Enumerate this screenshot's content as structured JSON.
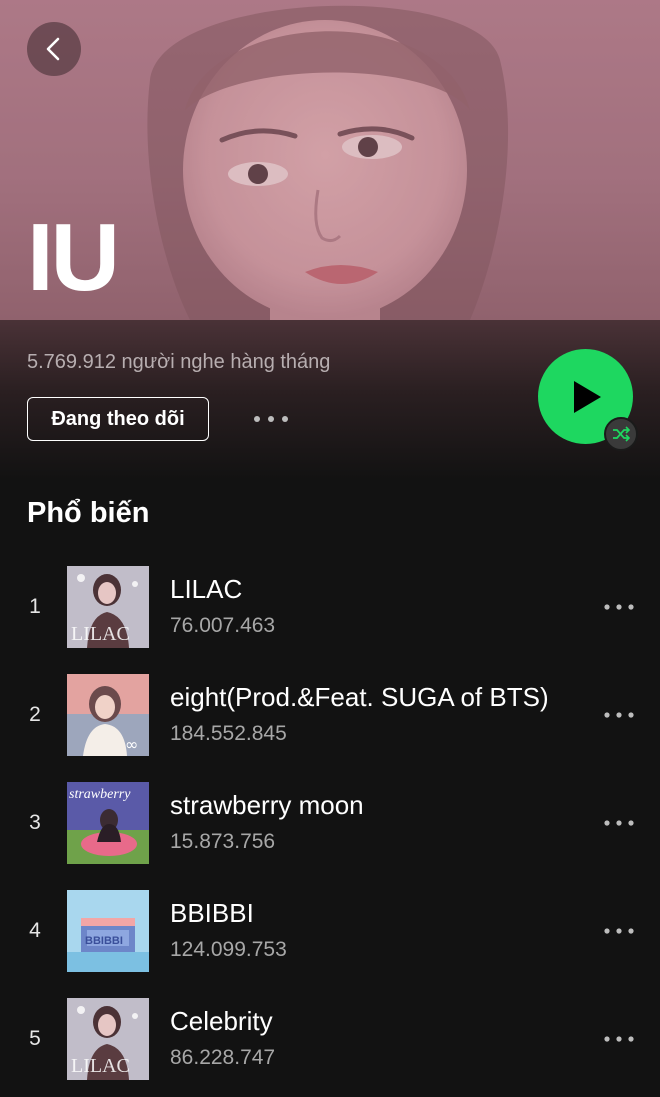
{
  "artist": {
    "name": "IU",
    "monthly_listeners": "5.769.912 người nghe hàng tháng",
    "follow_label": "Đang theo dõi"
  },
  "icons": {
    "back": "chevron-left-icon",
    "more": "more-horizontal-icon",
    "play": "play-icon",
    "shuffle": "shuffle-icon"
  },
  "colors": {
    "accent": "#1ed760",
    "background": "#121212",
    "hero": "#a47280",
    "secondary_text": "#a7a7a7"
  },
  "popular": {
    "title": "Phổ biến",
    "tracks": [
      {
        "rank": "1",
        "title": "LILAC",
        "plays": "76.007.463",
        "art_text": "LILAC"
      },
      {
        "rank": "2",
        "title": "eight(Prod.&Feat. SUGA of BTS)",
        "plays": "184.552.845",
        "art_text": "∞"
      },
      {
        "rank": "3",
        "title": "strawberry moon",
        "plays": "15.873.756",
        "art_text": "strawberry"
      },
      {
        "rank": "4",
        "title": "BBIBBI",
        "plays": "124.099.753",
        "art_text": "BBIBBI"
      },
      {
        "rank": "5",
        "title": "Celebrity",
        "plays": "86.228.747",
        "art_text": "LILAC"
      }
    ]
  }
}
